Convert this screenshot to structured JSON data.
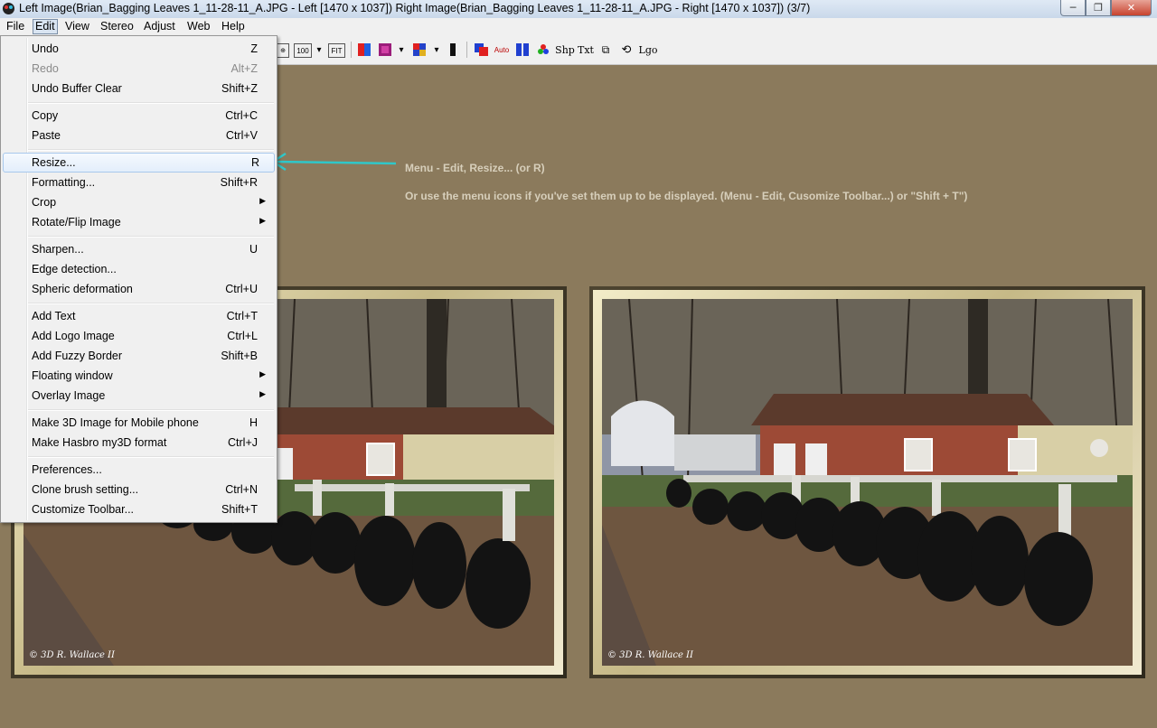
{
  "window": {
    "title": "Left Image(Brian_Bagging Leaves 1_11-28-11_A.JPG - Left [1470 x 1037]) Right Image(Brian_Bagging Leaves 1_11-28-11_A.JPG - Right [1470 x 1037])  (3/7)",
    "buttons": {
      "minimize": "─",
      "maximize": "❐",
      "close": "✕"
    }
  },
  "menubar": [
    "File",
    "Edit",
    "View",
    "Stereo",
    "Adjust",
    "Web",
    "Help"
  ],
  "toolbar": {
    "zoom_100": "100",
    "fit": "FIT",
    "shp": "Shp",
    "txt": "Txt",
    "lgo": "Lgo",
    "auto": "Auto"
  },
  "edit_menu": [
    {
      "label": "Undo",
      "shortcut": "Z"
    },
    {
      "label": "Redo",
      "shortcut": "Alt+Z",
      "disabled": true
    },
    {
      "label": "Undo Buffer Clear",
      "shortcut": "Shift+Z"
    },
    {
      "label": "Copy",
      "shortcut": "Ctrl+C"
    },
    {
      "label": "Paste",
      "shortcut": "Ctrl+V"
    },
    {
      "label": "Resize...",
      "shortcut": "R",
      "highlighted": true
    },
    {
      "label": "Formatting...",
      "shortcut": "Shift+R"
    },
    {
      "label": "Crop",
      "submenu": true
    },
    {
      "label": "Rotate/Flip Image",
      "submenu": true
    },
    {
      "label": "Sharpen...",
      "shortcut": "U"
    },
    {
      "label": "Edge detection..."
    },
    {
      "label": "Spheric deformation",
      "shortcut": "Ctrl+U"
    },
    {
      "label": "Add Text",
      "shortcut": "Ctrl+T"
    },
    {
      "label": "Add Logo Image",
      "shortcut": "Ctrl+L"
    },
    {
      "label": "Add Fuzzy Border",
      "shortcut": "Shift+B"
    },
    {
      "label": "Floating window",
      "submenu": true
    },
    {
      "label": "Overlay Image",
      "submenu": true
    },
    {
      "label": "Make 3D Image for Mobile phone",
      "shortcut": "H"
    },
    {
      "label": "Make Hasbro my3D format",
      "shortcut": "Ctrl+J"
    },
    {
      "label": "Preferences..."
    },
    {
      "label": "Clone brush setting...",
      "shortcut": "Ctrl+N"
    },
    {
      "label": "Customize Toolbar...",
      "shortcut": "Shift+T"
    }
  ],
  "annotations": {
    "line1": "Menu - Edit, Resize... (or R)",
    "line2": "Or use the menu icons if you've set them up to be displayed.  (Menu - Edit, Cusomize Toolbar...) or \"Shift + T\")"
  },
  "images": {
    "left_copyright": "© 3D R. Wallace II",
    "right_copyright": "© 3D R. Wallace II"
  },
  "colors": {
    "background": "#8b7a5c",
    "annotation_text": "#d7cfbb",
    "arrow": "#2fc7c9",
    "menu_highlight": "#e3eefb"
  }
}
